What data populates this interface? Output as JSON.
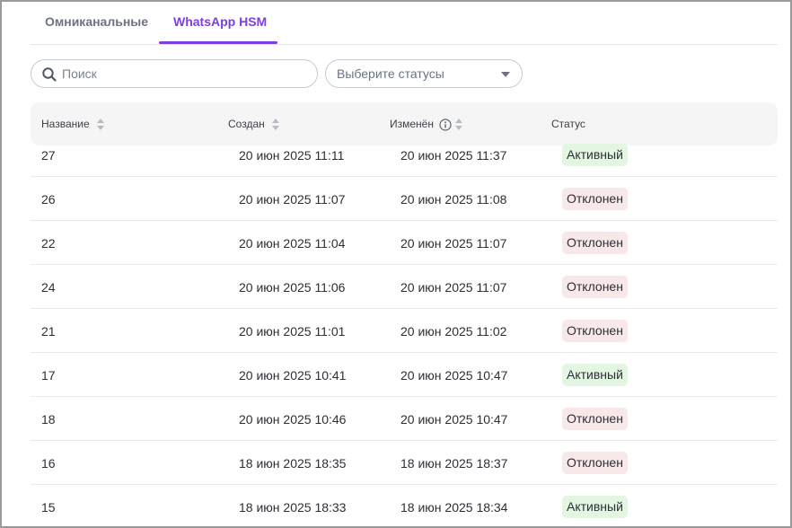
{
  "tabs": [
    {
      "label": "Омниканальные"
    },
    {
      "label": "WhatsApp HSM"
    }
  ],
  "search": {
    "placeholder": "Поиск",
    "value": ""
  },
  "status_filter": {
    "label": "Выберите статусы"
  },
  "table": {
    "columns": [
      "Название",
      "Создан",
      "Изменён",
      "Статус"
    ],
    "rows": [
      {
        "name": "27",
        "created": "20 июн 2025 11:11",
        "modified": "20 июн 2025 11:37",
        "status": "Активный",
        "status_kind": "active"
      },
      {
        "name": "26",
        "created": "20 июн 2025 11:07",
        "modified": "20 июн 2025 11:08",
        "status": "Отклонен",
        "status_kind": "rejected"
      },
      {
        "name": "22",
        "created": "20 июн 2025 11:04",
        "modified": "20 июн 2025 11:07",
        "status": "Отклонен",
        "status_kind": "rejected"
      },
      {
        "name": "24",
        "created": "20 июн 2025 11:06",
        "modified": "20 июн 2025 11:07",
        "status": "Отклонен",
        "status_kind": "rejected"
      },
      {
        "name": "21",
        "created": "20 июн 2025 11:01",
        "modified": "20 июн 2025 11:02",
        "status": "Отклонен",
        "status_kind": "rejected"
      },
      {
        "name": "17",
        "created": "20 июн 2025 10:41",
        "modified": "20 июн 2025 10:47",
        "status": "Активный",
        "status_kind": "active"
      },
      {
        "name": "18",
        "created": "20 июн 2025 10:46",
        "modified": "20 июн 2025 10:47",
        "status": "Отклонен",
        "status_kind": "rejected"
      },
      {
        "name": "16",
        "created": "18 июн 2025 18:35",
        "modified": "18 июн 2025 18:37",
        "status": "Отклонен",
        "status_kind": "rejected"
      },
      {
        "name": "15",
        "created": "18 июн 2025 18:33",
        "modified": "18 июн 2025 18:34",
        "status": "Активный",
        "status_kind": "active"
      }
    ]
  },
  "colors": {
    "accent": "#7b3fe4",
    "active_bg": "#e3f6e2",
    "rejected_bg": "#f8e8e9"
  }
}
